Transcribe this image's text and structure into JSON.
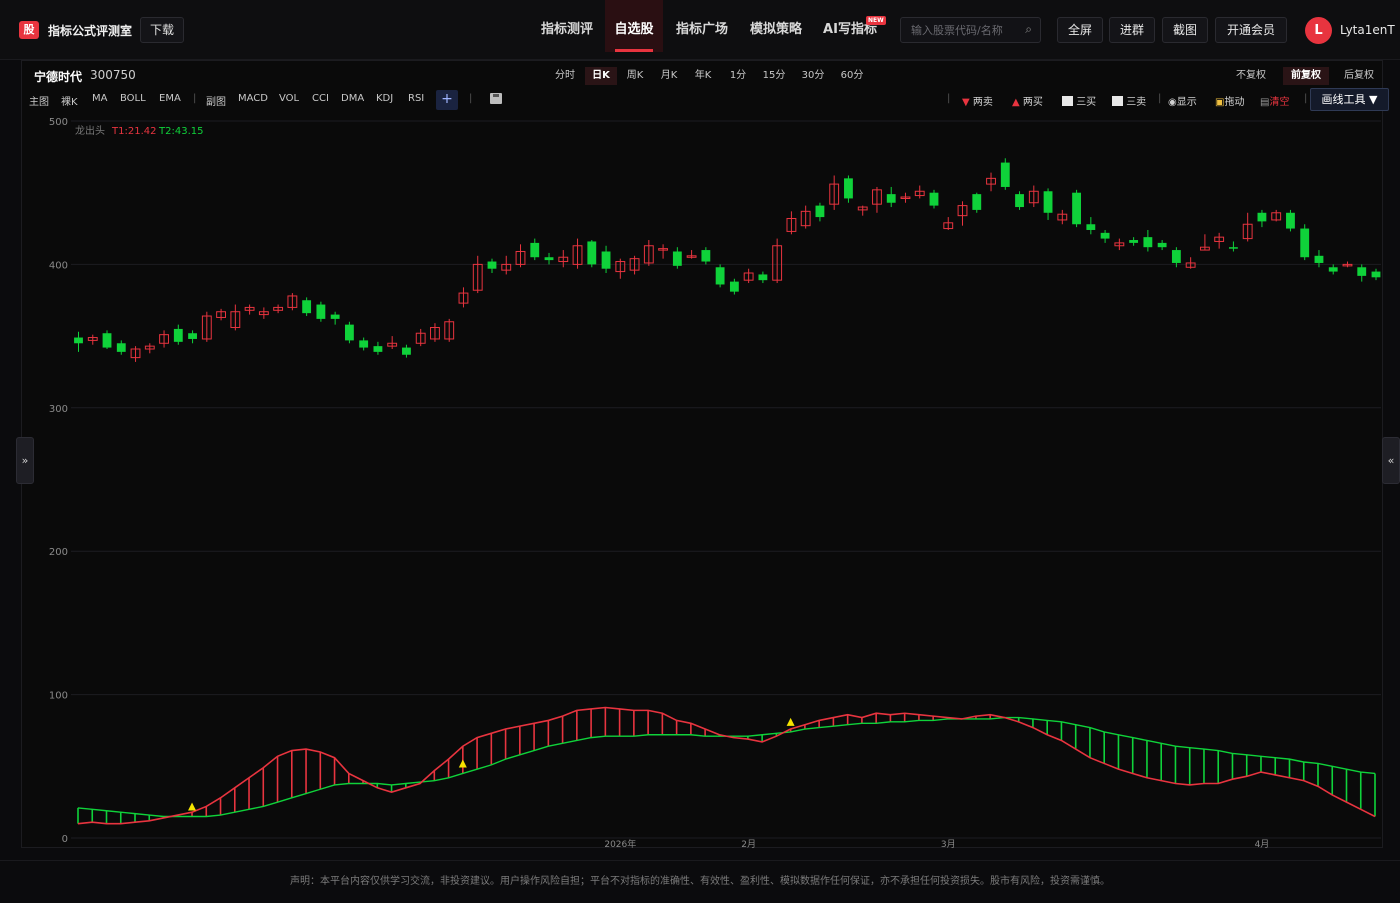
{
  "header": {
    "logo_char": "股",
    "app_title": "指标公式评测室",
    "download_label": "下载",
    "nav": [
      {
        "label": "指标测评",
        "active": false
      },
      {
        "label": "自选股",
        "active": true
      },
      {
        "label": "指标广场",
        "active": false
      },
      {
        "label": "模拟策略",
        "active": false
      },
      {
        "label": "AI写指标",
        "active": false,
        "badge": "NEW"
      }
    ],
    "search_placeholder": "输入股票代码/名称",
    "buttons": {
      "fullscreen": "全屏",
      "join_group": "进群",
      "screenshot": "截图",
      "membership": "开通会员"
    },
    "avatar_letter": "L",
    "username": "Lyta1enT"
  },
  "stock": {
    "name": "宁德时代",
    "code": "300750"
  },
  "periods": [
    "分时",
    "日K",
    "周K",
    "月K",
    "年K",
    "1分",
    "15分",
    "30分",
    "60分"
  ],
  "active_period": "日K",
  "adjust": {
    "options": [
      "不复权",
      "前复权",
      "后复权"
    ],
    "active": "前复权"
  },
  "indicators": {
    "main": [
      "主图",
      "裸K",
      "MA",
      "BOLL",
      "EMA"
    ],
    "sub": [
      "副图",
      "MACD",
      "VOL",
      "CCI",
      "DMA",
      "KDJ",
      "RSI"
    ],
    "add_label": "+"
  },
  "tools": {
    "two_sell": "两卖",
    "two_buy": "两买",
    "three_buy": "三买",
    "three_sell": "三卖",
    "show": "显示",
    "drag": "拖动",
    "clear": "清空",
    "draw_tools": "画线工具 ▼"
  },
  "side_handles": {
    "left": "»",
    "right": "«"
  },
  "footer": "声明：本平台内容仅供学习交流，非投资建议。用户操作风险自担；平台不对指标的准确性、有效性、盈利性、模拟数据作任何保证，亦不承担任何投资损失。股市有风险，投资需谨慎。",
  "colors": {
    "up": "#e8343f",
    "down": "#0fd23a",
    "bg": "#0a0a0a",
    "grid": "#1c1c22",
    "marker": "#f5e400"
  },
  "chart_data": {
    "type": "candlestick",
    "indicator_label": "龙出头",
    "t1_label": "T1:21.42",
    "t2_label": "T2:43.15",
    "y_ticks": [
      500,
      400,
      300,
      200,
      100,
      0
    ],
    "ylim": [
      0,
      500
    ],
    "x_labels": [
      {
        "label": "2026年",
        "index": 38
      },
      {
        "label": "2月",
        "index": 47
      },
      {
        "label": "3月",
        "index": 61
      },
      {
        "label": "4月",
        "index": 83
      }
    ],
    "candles": [
      [
        349,
        345,
        353,
        339
      ],
      [
        347,
        349,
        351,
        344
      ],
      [
        352,
        342,
        354,
        341
      ],
      [
        345,
        339,
        347,
        337
      ],
      [
        335,
        341,
        343,
        332
      ],
      [
        341,
        343,
        345,
        338
      ],
      [
        345,
        351,
        354,
        342
      ],
      [
        355,
        346,
        358,
        344
      ],
      [
        352,
        348,
        354,
        345
      ],
      [
        348,
        364,
        367,
        346
      ],
      [
        363,
        367,
        369,
        361
      ],
      [
        356,
        367,
        372,
        354
      ],
      [
        368,
        370,
        372,
        365
      ],
      [
        365,
        367,
        370,
        362
      ],
      [
        368,
        370,
        372,
        366
      ],
      [
        370,
        378,
        380,
        368
      ],
      [
        375,
        366,
        377,
        364
      ],
      [
        372,
        362,
        374,
        360
      ],
      [
        365,
        362,
        367,
        358
      ],
      [
        358,
        347,
        360,
        345
      ],
      [
        347,
        342,
        349,
        340
      ],
      [
        343,
        339,
        346,
        337
      ],
      [
        343,
        345,
        350,
        341
      ],
      [
        342,
        337,
        344,
        335
      ],
      [
        345,
        352,
        355,
        343
      ],
      [
        348,
        356,
        359,
        346
      ],
      [
        348,
        360,
        362,
        346
      ],
      [
        373,
        380,
        384,
        370
      ],
      [
        382,
        400,
        406,
        380
      ],
      [
        402,
        397,
        404,
        394
      ],
      [
        396,
        400,
        406,
        393
      ],
      [
        400,
        409,
        414,
        398
      ],
      [
        415,
        405,
        418,
        403
      ],
      [
        405,
        403,
        408,
        400
      ],
      [
        402,
        405,
        410,
        398
      ],
      [
        400,
        413,
        418,
        397
      ],
      [
        416,
        400,
        417,
        398
      ],
      [
        409,
        397,
        413,
        394
      ],
      [
        395,
        402,
        404,
        390
      ],
      [
        396,
        404,
        406,
        393
      ],
      [
        401,
        413,
        417,
        399
      ],
      [
        410,
        411,
        414,
        404
      ],
      [
        409,
        399,
        412,
        397
      ],
      [
        406,
        406,
        410,
        404
      ],
      [
        410,
        402,
        412,
        400
      ],
      [
        398,
        386,
        400,
        384
      ],
      [
        388,
        381,
        390,
        379
      ],
      [
        389,
        394,
        397,
        387
      ],
      [
        393,
        389,
        395,
        387
      ],
      [
        389,
        413,
        418,
        387
      ],
      [
        423,
        432,
        437,
        421
      ],
      [
        427,
        437,
        441,
        425
      ],
      [
        441,
        433,
        443,
        430
      ],
      [
        442,
        456,
        462,
        438
      ],
      [
        460,
        446,
        462,
        443
      ],
      [
        438,
        440,
        441,
        434
      ],
      [
        442,
        452,
        454,
        436
      ],
      [
        449,
        443,
        454,
        440
      ],
      [
        446,
        447,
        450,
        443
      ],
      [
        448,
        451,
        455,
        446
      ],
      [
        450,
        441,
        452,
        439
      ],
      [
        425,
        429,
        433,
        424
      ],
      [
        434,
        441,
        444,
        427
      ],
      [
        449,
        438,
        450,
        436
      ],
      [
        456,
        460,
        464,
        451
      ],
      [
        471,
        454,
        474,
        452
      ],
      [
        449,
        440,
        451,
        438
      ],
      [
        443,
        451,
        455,
        440
      ],
      [
        451,
        436,
        453,
        431
      ],
      [
        431,
        435,
        438,
        428
      ],
      [
        450,
        428,
        452,
        426
      ],
      [
        428,
        424,
        433,
        421
      ],
      [
        422,
        418,
        424,
        415
      ],
      [
        413,
        415,
        418,
        410
      ],
      [
        417,
        415,
        419,
        413
      ],
      [
        419,
        412,
        424,
        409
      ],
      [
        415,
        412,
        417,
        410
      ],
      [
        410,
        401,
        412,
        398
      ],
      [
        398,
        401,
        405,
        397
      ],
      [
        410,
        412,
        421,
        410
      ],
      [
        416,
        419,
        422,
        411
      ],
      [
        412,
        411,
        416,
        409
      ],
      [
        418,
        428,
        436,
        416
      ],
      [
        436,
        430,
        438,
        426
      ],
      [
        431,
        436,
        438,
        430
      ],
      [
        436,
        425,
        438,
        423
      ],
      [
        425,
        405,
        428,
        403
      ],
      [
        406,
        401,
        410,
        398
      ],
      [
        398,
        395,
        400,
        393
      ],
      [
        400,
        400,
        402,
        398
      ],
      [
        398,
        392,
        400,
        388
      ],
      [
        395,
        391,
        397,
        389
      ]
    ],
    "fast_line": [
      10,
      11,
      10,
      10,
      11,
      12,
      14,
      16,
      18,
      22,
      28,
      35,
      42,
      49,
      57,
      61,
      62,
      60,
      56,
      45,
      40,
      35,
      32,
      35,
      38,
      47,
      55,
      64,
      70,
      73,
      76,
      78,
      80,
      82,
      85,
      89,
      90,
      91,
      90,
      89,
      89,
      87,
      82,
      80,
      76,
      72,
      70,
      69,
      67,
      71,
      76,
      79,
      82,
      84,
      86,
      84,
      87,
      86,
      87,
      86,
      85,
      84,
      83,
      85,
      86,
      84,
      81,
      77,
      72,
      68,
      62,
      56,
      52,
      48,
      45,
      42,
      40,
      38,
      37,
      38,
      38,
      41,
      43,
      46,
      44,
      42,
      40,
      36,
      30,
      25,
      20,
      15
    ],
    "slow_line": [
      21,
      20,
      19,
      18,
      17,
      16,
      15,
      15,
      15,
      15,
      16,
      18,
      20,
      22,
      25,
      28,
      31,
      34,
      37,
      38,
      38,
      38,
      37,
      38,
      39,
      40,
      42,
      45,
      48,
      51,
      55,
      58,
      61,
      64,
      66,
      68,
      70,
      71,
      71,
      71,
      72,
      72,
      72,
      72,
      71,
      71,
      71,
      71,
      72,
      73,
      74,
      76,
      77,
      78,
      79,
      80,
      80,
      81,
      81,
      82,
      82,
      83,
      83,
      83,
      83,
      84,
      84,
      83,
      82,
      81,
      79,
      77,
      74,
      72,
      70,
      68,
      66,
      64,
      63,
      62,
      61,
      59,
      58,
      57,
      56,
      55,
      53,
      52,
      50,
      48,
      46,
      45
    ],
    "markers": [
      8,
      27,
      50
    ]
  }
}
